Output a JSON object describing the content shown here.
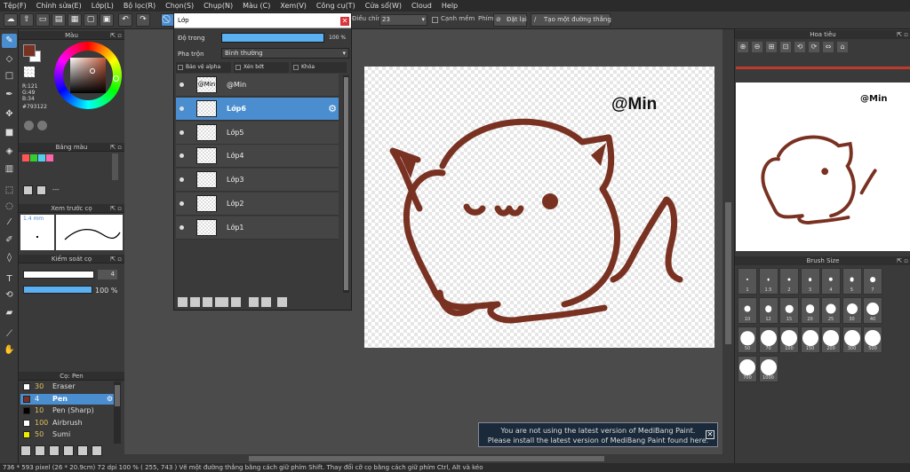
{
  "menu": [
    "Tệp(F)",
    "Chỉnh sửa(E)",
    "Lớp(L)",
    "Bộ lọc(R)",
    "Chọn(S)",
    "Chụp(N)",
    "Màu (C)",
    "Xem(V)",
    "Công cụ(T)",
    "Cửa sổ(W)",
    "Cloud",
    "Help"
  ],
  "toolbar": {
    "stabilizer_label": "Điều chỉnh",
    "stabilizer_value": "23",
    "smooth_label": "Cạnh mềm",
    "key_label": "Phím",
    "reset_label": "Đặt lại",
    "straight_label": "Tạo một đường thẳng"
  },
  "color": {
    "title": "Màu",
    "r": "R:121",
    "g": "G:49",
    "b": "B:34",
    "hex": "#793122",
    "main": "#793122"
  },
  "palette": {
    "title": "Bảng màu",
    "swatches": [
      "#f55",
      "#3c3",
      "#5ce",
      "#f6a"
    ]
  },
  "preview": {
    "title": "Xem trước cọ",
    "size": "1.4 mm"
  },
  "brush_control": {
    "title": "Kiểm soát cọ",
    "size_value": "4",
    "opacity_value": "100 %",
    "size_fraction": 0.6,
    "opacity_fraction": 1.0
  },
  "brush_list": {
    "title": "Cọ: Pen",
    "items": [
      {
        "size": "30",
        "name": "Eraser",
        "color": "#fff",
        "selected": false
      },
      {
        "size": "4",
        "name": "Pen",
        "color": "#793122",
        "selected": true
      },
      {
        "size": "10",
        "name": "Pen (Sharp)",
        "color": "#000",
        "selected": false
      },
      {
        "size": "100",
        "name": "Airbrush",
        "color": "#fff",
        "selected": false
      },
      {
        "size": "50",
        "name": "Sumi",
        "color": "#ee0",
        "selected": false
      }
    ]
  },
  "layer_panel": {
    "title": "Lớp",
    "opacity_label": "Độ trong",
    "opacity_value": "100 %",
    "opacity_fraction": 1.0,
    "blend_label": "Pha trộn",
    "blend_value": "Bình thường",
    "protect_alpha": "Bảo vệ alpha",
    "clip": "Xén bớt",
    "lock": "Khóa",
    "layers": [
      {
        "name": "@Min",
        "thumb": "@Min",
        "selected": false
      },
      {
        "name": "Lớp6",
        "thumb": "",
        "selected": true
      },
      {
        "name": "Lớp5",
        "thumb": "",
        "selected": false
      },
      {
        "name": "Lớp4",
        "thumb": "",
        "selected": false
      },
      {
        "name": "Lớp3",
        "thumb": "",
        "selected": false
      },
      {
        "name": "Lớp2",
        "thumb": "",
        "selected": false
      },
      {
        "name": "Lớp1",
        "thumb": "",
        "selected": false
      }
    ]
  },
  "canvas": {
    "watermark": "@Min",
    "line_color": "#793122"
  },
  "navigator": {
    "title": "Hoa tiêu",
    "watermark": "@Min"
  },
  "brush_size": {
    "title": "Brush Size",
    "sizes": [
      "1",
      "1.5",
      "2",
      "3",
      "4",
      "5",
      "7",
      "10",
      "12",
      "15",
      "20",
      "25",
      "30",
      "40",
      "50",
      "70",
      "100",
      "150",
      "200",
      "300",
      "500",
      "700",
      "1000"
    ]
  },
  "notice": {
    "line1": "You are not using the latest version of MediBang Paint.",
    "line2": "Please install the latest version of MediBang Paint found here."
  },
  "status": "736 * 593 pixel  (26 * 20.9cm)  72 dpi  100 %  ( 255, 743 )  Vẽ một đường thẳng bằng cách giữ phím Shift. Thay đổi cỡ cọ bằng cách giữ phím Ctrl, Alt và kéo"
}
